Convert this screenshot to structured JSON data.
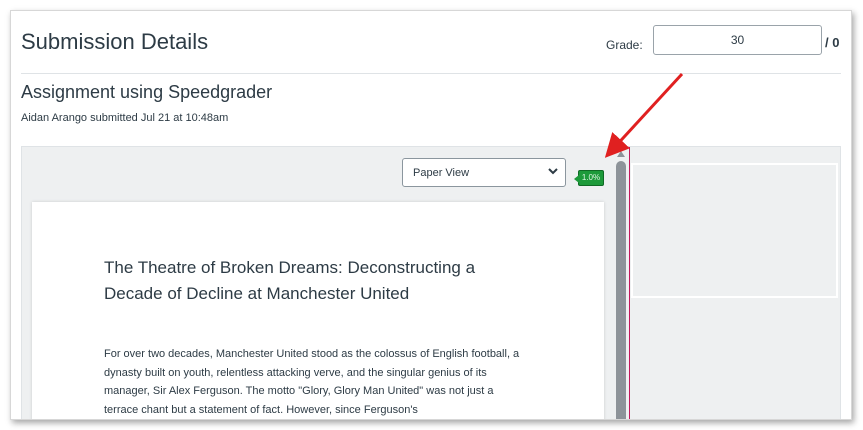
{
  "header": {
    "title": "Submission Details",
    "grade_label": "Grade:",
    "grade_value": "30",
    "grade_max": "/ 0"
  },
  "assignment": {
    "title": "Assignment using Speedgrader",
    "submitted_line": "Aidan Arango submitted Jul 21 at 10:48am"
  },
  "viewer": {
    "view_mode": "Paper View",
    "zoom_badge": "1.0%"
  },
  "document": {
    "title": "The Theatre of Broken Dreams: Deconstructing a Decade of Decline at Manchester United",
    "body": "For over two decades, Manchester United stood as the colossus of English football, a dynasty built on youth, relentless attacking verve, and the singular genius of its manager, Sir Alex Ferguson. The motto \"Glory, Glory Man United\" was not just a terrace chant but a statement of fact. However, since Ferguson's"
  },
  "colors": {
    "annotation_arrow": "#e02020",
    "badge_green": "#1d9a3a",
    "divider_pink": "#c2185b"
  }
}
